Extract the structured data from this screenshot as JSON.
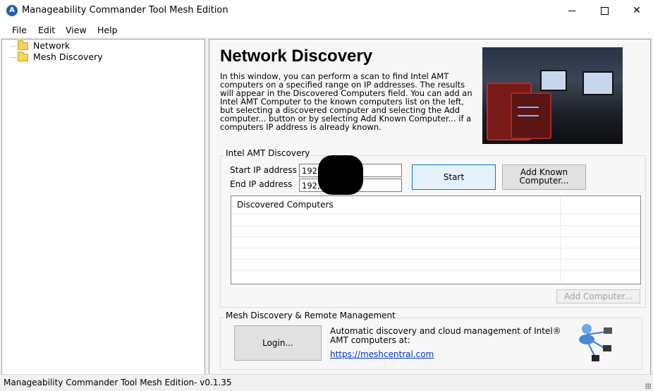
{
  "window": {
    "title": "Manageability Commander Tool Mesh Edition",
    "app_icon": "A",
    "controls": {
      "minimize": "",
      "maximize": "",
      "close": "✕"
    }
  },
  "menu": [
    "File",
    "Edit",
    "View",
    "Help"
  ],
  "tree": {
    "items": [
      {
        "label": "Network",
        "icon": "folder-icon"
      },
      {
        "label": "Mesh Discovery",
        "icon": "folder-icon"
      }
    ]
  },
  "main": {
    "title": "Network Discovery",
    "description": "In this window, you can perform a scan to find Intel AMT computers on a specified range on IP addresses. The results will appear in the Discovered Computers field. You can add an Intel AMT Computer to the known computers list on the left, but selecting a discovered computer and selecting the Add computer... button or by selecting Add Known Computer... if a computers IP address is already known.",
    "amt": {
      "group_label": "Intel AMT Discovery",
      "start_label": "Start IP address",
      "start_value": "192,",
      "end_label": "End IP address",
      "end_value": "192,",
      "start_button": "Start",
      "add_known_button": "Add Known\nComputer...",
      "list_header": "Discovered Computers",
      "add_computer_button": "Add Computer..."
    },
    "mesh": {
      "group_label": "Mesh Discovery & Remote Management",
      "login_button": "Login...",
      "description_line1": "Automatic discovery and cloud management of Intel®",
      "description_line2": "AMT computers at:",
      "link": "https://meshcentral.com",
      "icon": "network-users-icon"
    }
  },
  "status": {
    "text": "Manageability Commander Tool Mesh Edition- v0.1.35"
  }
}
